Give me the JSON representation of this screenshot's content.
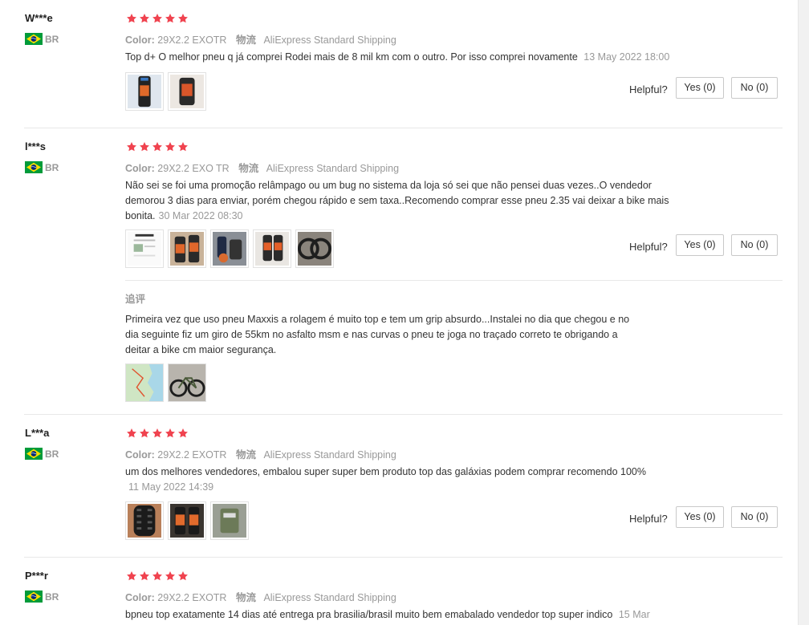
{
  "reviews": [
    {
      "user": "W***e",
      "country": "BR",
      "color_label": "Color:",
      "color_value": "29X2.2 EXOTR",
      "shipping_label": "物流",
      "shipping_value": "AliExpress Standard Shipping",
      "text": "Top d+ O melhor pneu q já comprei Rodei mais de 8 mil km com o outro. Por isso comprei novamente",
      "date": "13 May 2022 18:00",
      "helpful_label": "Helpful?",
      "yes_label": "Yes (0)",
      "no_label": "No (0)"
    },
    {
      "user": "l***s",
      "country": "BR",
      "color_label": "Color:",
      "color_value": "29X2.2 EXO TR",
      "shipping_label": "物流",
      "shipping_value": "AliExpress Standard Shipping",
      "text_line1": "Não sei se foi uma promoção relâmpago ou um bug no sistema da loja só sei que não pensei duas vezes..O vendedor",
      "text_line2": "demorou 3 dias para enviar, porém chegou rápido e sem taxa..Recomendo comprar esse pneu 2.35 vai deixar a bike mais",
      "text_line3": "bonita.",
      "date": "30 Mar 2022 08:30",
      "helpful_label": "Helpful?",
      "yes_label": "Yes (0)",
      "no_label": "No (0)",
      "followup_label": "追评",
      "followup_line1": "Primeira vez que uso pneu Maxxis a rolagem é muito top e tem um grip absurdo...Instalei no dia que chegou e no",
      "followup_line2": "dia seguinte fiz um giro de 55km no asfalto msm e nas curvas o pneu te joga no traçado correto te obrigando a",
      "followup_line3": "deitar a bike cm maior segurança."
    },
    {
      "user": "L***a",
      "country": "BR",
      "color_label": "Color:",
      "color_value": "29X2.2 EXOTR",
      "shipping_label": "物流",
      "shipping_value": "AliExpress Standard Shipping",
      "text": "um dos melhores vendedores, embalou super super bem produto top das galáxias podem comprar recomendo 100%",
      "date": "11 May 2022 14:39",
      "helpful_label": "Helpful?",
      "yes_label": "Yes (0)",
      "no_label": "No (0)"
    },
    {
      "user": "P***r",
      "country": "BR",
      "color_label": "Color:",
      "color_value": "29X2.2 EXOTR",
      "shipping_label": "物流",
      "shipping_value": "AliExpress Standard Shipping",
      "text": "bpneu top exatamente 14 dias até entrega pra brasilia/brasil muito bem emabalado vendedor top super indico",
      "date": "15 Mar"
    }
  ],
  "colors": {
    "star": "#f0434f",
    "accent_gray": "#999999",
    "flag_green": "#009b3a",
    "flag_yellow": "#fedf00",
    "flag_blue": "#002776"
  },
  "icons": {
    "star": "star-icon",
    "flag": "brazil-flag-icon"
  }
}
